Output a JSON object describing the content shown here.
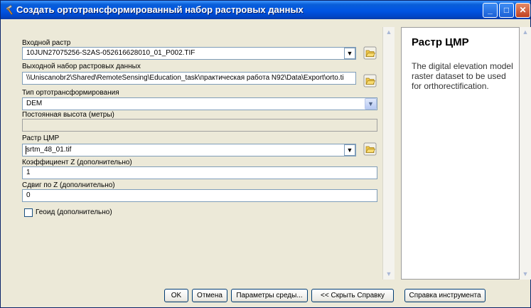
{
  "window": {
    "title": "Создать ортотрансформированный набор растровых данных",
    "controls": {
      "minimize": "_",
      "maximize": "□",
      "close": "✕"
    }
  },
  "params": {
    "input_raster": {
      "label": "Входной растр",
      "value": "10JUN27075256-S2AS-052616628010_01_P002.TIF"
    },
    "output_dataset": {
      "label": "Выходной набор растровых данных",
      "value": "\\\\Uniscanobr2\\Shared\\RemoteSensing\\Education_task\\практическая работа N92\\Data\\Export\\orto.ti"
    },
    "ortho_type": {
      "label": "Тип ортотрансформирования",
      "value": "DEM"
    },
    "constant_elevation": {
      "label": "Постоянная высота (метры)",
      "value": ""
    },
    "dem_raster": {
      "label": "Растр ЦМР",
      "value": "srtm_48_01.tif"
    },
    "z_factor": {
      "label": "Коэффициент Z (дополнительно)",
      "value": "1"
    },
    "z_offset": {
      "label": "Сдвиг по Z (дополнительно)",
      "value": "0"
    },
    "geoid": {
      "label": "Геоид (дополнительно)",
      "checked": false
    }
  },
  "help": {
    "title": "Растр ЦМР",
    "body": "The digital elevation model raster dataset to be used for orthorectification."
  },
  "buttons": {
    "ok": "OK",
    "cancel": "Отмена",
    "environments": "Параметры среды...",
    "hide_help": "<< Скрыть Справку",
    "tool_help": "Справка инструмента"
  },
  "icons": {
    "title": "tool-hammer-icon",
    "folder": "open-folder-icon",
    "dropdown": "chevron-down-icon"
  }
}
